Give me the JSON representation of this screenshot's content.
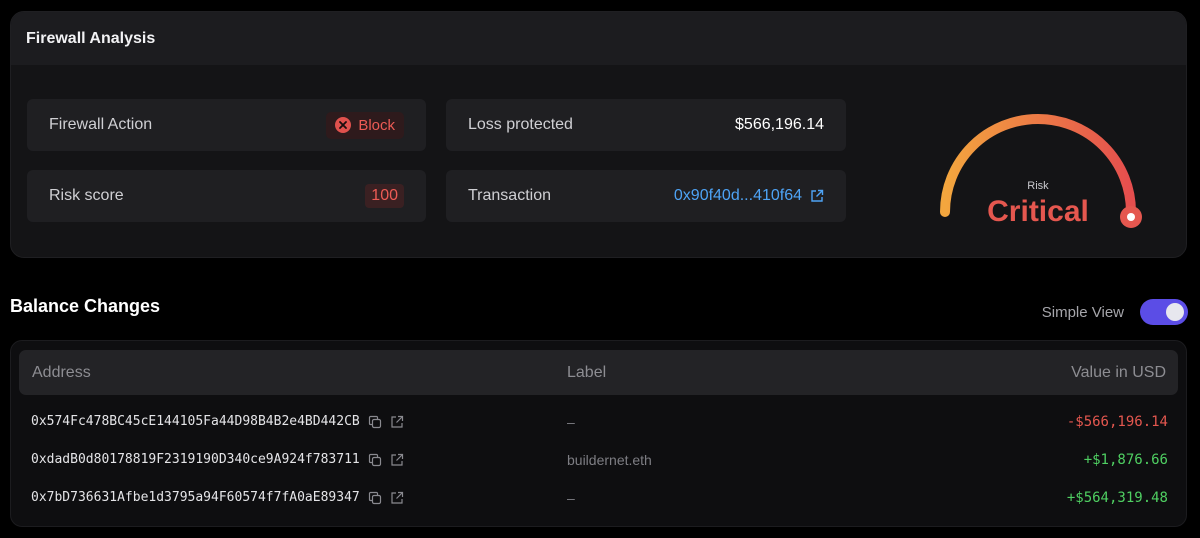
{
  "firewall": {
    "title": "Firewall Analysis",
    "action": {
      "label": "Firewall Action",
      "value": "Block"
    },
    "risk_score": {
      "label": "Risk score",
      "value": "100"
    },
    "loss": {
      "label": "Loss protected",
      "value": "$566,196.14"
    },
    "transaction": {
      "label": "Transaction",
      "value": "0x90f40d...410f64"
    },
    "gauge": {
      "caption": "Risk",
      "level": "Critical",
      "level_fraction": 1.0
    }
  },
  "balance": {
    "title": "Balance Changes",
    "view_label": "Simple View",
    "simple_view_enabled": true,
    "columns": [
      "Address",
      "Label",
      "Value in USD"
    ],
    "rows": [
      {
        "address": "0x574Fc478BC45cE144105Fa44D98B4B2e4BD442CB",
        "label": "–",
        "value": "-$566,196.14",
        "sign": "negative"
      },
      {
        "address": "0xdadB0d80178819F2319190D340ce9A924f783711",
        "label": "buildernet.eth",
        "value": "+$1,876.66",
        "sign": "positive"
      },
      {
        "address": "0x7bD736631Afbe1d3795a94F60574f7fA0aE89347",
        "label": "–",
        "value": "+$564,319.48",
        "sign": "positive"
      }
    ]
  },
  "colors": {
    "danger": "#e5574f",
    "positive": "#4fcf62",
    "link": "#4ea3f5",
    "toggle": "#5b4de6",
    "gauge_start": "#f3a63e",
    "gauge_end": "#e54e4e"
  },
  "icons": [
    "close-circle-icon",
    "external-link-icon",
    "copy-icon"
  ]
}
